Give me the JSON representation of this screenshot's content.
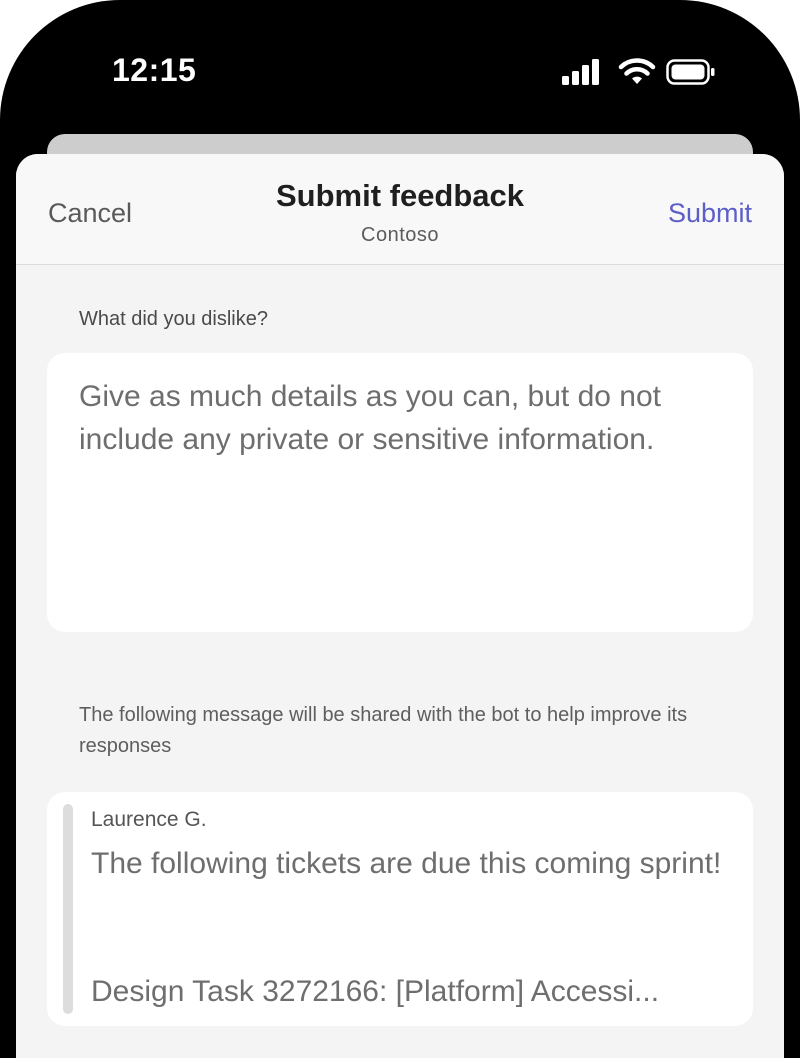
{
  "status_bar": {
    "time": "12:15",
    "icons": [
      "cellular-signal-icon",
      "wifi-icon",
      "battery-icon"
    ]
  },
  "header": {
    "cancel_label": "Cancel",
    "title": "Submit feedback",
    "subtitle": "Contoso",
    "submit_label": "Submit"
  },
  "form": {
    "question_label": "What did you dislike?",
    "feedback_placeholder": "Give as much details as you can, but do not include any private or sensitive information.",
    "share_note": "The following message will be shared with the bot to help improve its responses"
  },
  "shared_message": {
    "author": "Laurence G.",
    "body": "The following tickets are due this coming sprint!",
    "ticket_line": "Design Task 3272166: [Platform] Accessi..."
  },
  "colors": {
    "accent": "#5b5fc7",
    "sheet_background": "#f4f4f4",
    "card_background": "#ffffff"
  }
}
